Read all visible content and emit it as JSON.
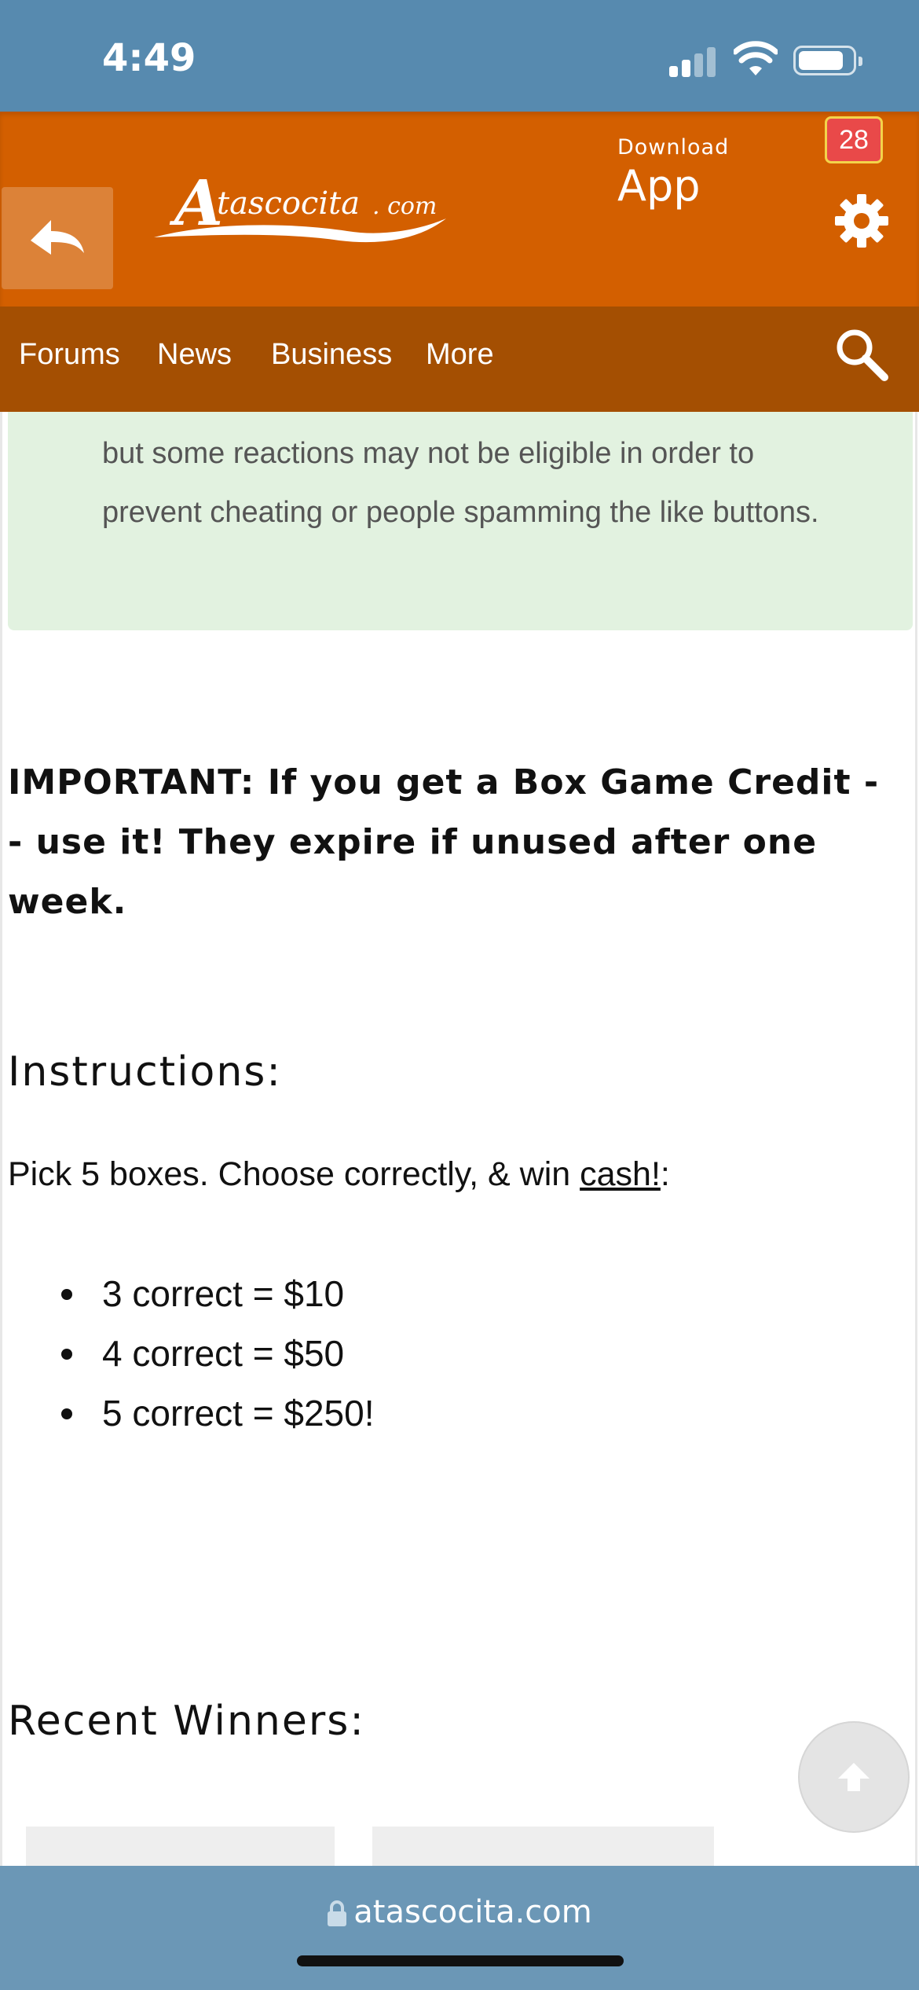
{
  "status_bar": {
    "time": "4:49"
  },
  "header": {
    "logo_alt": "Atascocita.com",
    "download_small": "Download",
    "download_big": "App",
    "notification_count": "28",
    "colors": {
      "header_bg": "#d35f00",
      "nav_bg": "#a44f02",
      "badge": "#e94949"
    }
  },
  "nav": {
    "items": [
      {
        "label": "Forums"
      },
      {
        "label": "News"
      },
      {
        "label": "Business"
      },
      {
        "label": "More"
      }
    ]
  },
  "content": {
    "info_text": "but some reactions may not be eligible in order to prevent cheating or people spamming the like buttons.",
    "important": "IMPORTANT: If you get a Box Game Credit -- use it! They expire if unused after one week.",
    "instructions_heading": "Instructions:",
    "pick_text_before": "Pick 5 boxes. Choose correctly, & win ",
    "pick_link": "cash!",
    "pick_text_after": ":",
    "prizes": [
      "3 correct = $10",
      "4 correct = $50",
      "5 correct = $250!"
    ],
    "winners_heading": "Recent Winners:"
  },
  "browser": {
    "url": "atascocita.com"
  }
}
